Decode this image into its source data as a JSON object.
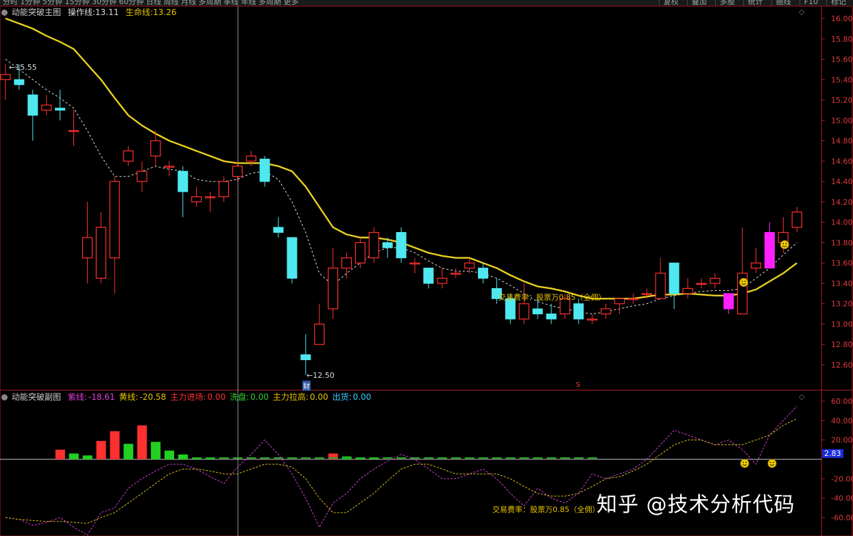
{
  "toolbar": {
    "left_text": "分时 1分钟 5分钟 15分钟 30分钟 60分钟 日线 周线 月线 多周期 季线 年线 多周期 更多",
    "right_items": [
      "复权",
      "叠加",
      "多股",
      "统计",
      "画线",
      "F10",
      "标记"
    ]
  },
  "main_panel": {
    "indicator_name": "动能突破主图",
    "op_label": "操作线:",
    "op_value": "13.11",
    "life_label": "生命线:",
    "life_value": "13.26",
    "high_label": "15.55",
    "low_label": "12.50",
    "annotation": "交易费率：股票万0.85（全佣）",
    "cai_tag": "财",
    "s_marker": "S"
  },
  "sub_panel": {
    "indicator_name": "动能突破副图",
    "items": [
      {
        "label": "紫线:",
        "value": "-18.61",
        "color": "#e040e0"
      },
      {
        "label": "黄线:",
        "value": "-20.58",
        "color": "#e6c200"
      },
      {
        "label": "主力进场:",
        "value": "0.00",
        "color": "#ff3030"
      },
      {
        "label": "洗盘:",
        "value": "0.00",
        "color": "#30d030"
      },
      {
        "label": "主力拉高:",
        "value": "0.00",
        "color": "#e6c200"
      },
      {
        "label": "出货:",
        "value": "0.00",
        "color": "#30d0ff"
      }
    ],
    "annotation": "交易费率：股票万0.85（全佣）",
    "current_value": "2.83"
  },
  "watermark": "知乎 @技术分析代码",
  "colors": {
    "up": "#ff3030",
    "down": "#4fe8f0",
    "yellow": "#e8d020",
    "magenta": "#ff20ff",
    "axis": "#b02020"
  },
  "chart_data": [
    {
      "type": "candlestick",
      "title": "动能突破主图",
      "ylim": [
        12.4,
        16.1
      ],
      "yticks": [
        "16.00",
        "15.80",
        "15.60",
        "15.40",
        "15.20",
        "15.00",
        "14.80",
        "14.60",
        "14.40",
        "14.20",
        "14.00",
        "13.80",
        "13.60",
        "13.40",
        "13.20",
        "13.00",
        "12.80",
        "12.60"
      ],
      "candles": [
        [
          15.4,
          15.45,
          15.55,
          15.2
        ],
        [
          15.4,
          15.35,
          15.55,
          15.3
        ],
        [
          15.25,
          15.05,
          15.3,
          14.8
        ],
        [
          15.1,
          15.15,
          15.25,
          15.05
        ],
        [
          15.12,
          15.1,
          15.3,
          15.0
        ],
        [
          14.9,
          14.9,
          15.1,
          14.75
        ],
        [
          13.65,
          13.85,
          14.2,
          13.4
        ],
        [
          13.45,
          13.95,
          14.1,
          13.4
        ],
        [
          13.65,
          14.4,
          14.45,
          13.3
        ],
        [
          14.6,
          14.7,
          14.75,
          14.55
        ],
        [
          14.4,
          14.5,
          14.6,
          14.3
        ],
        [
          14.65,
          14.8,
          14.9,
          14.55
        ],
        [
          14.55,
          14.55,
          14.6,
          14.45
        ],
        [
          14.5,
          14.3,
          14.55,
          14.05
        ],
        [
          14.2,
          14.25,
          14.35,
          14.15
        ],
        [
          14.25,
          14.25,
          14.3,
          14.1
        ],
        [
          14.25,
          14.4,
          14.45,
          14.2
        ],
        [
          14.45,
          14.55,
          14.6,
          14.4
        ],
        [
          14.6,
          14.65,
          14.7,
          14.55
        ],
        [
          14.62,
          14.4,
          14.65,
          14.35
        ],
        [
          13.95,
          13.9,
          14.05,
          13.85
        ],
        [
          13.85,
          13.45,
          13.85,
          13.4
        ],
        [
          12.7,
          12.65,
          12.9,
          12.5
        ],
        [
          12.8,
          13.0,
          13.2,
          12.8
        ],
        [
          13.15,
          13.55,
          13.75,
          13.05
        ],
        [
          13.55,
          13.65,
          13.7,
          13.45
        ],
        [
          13.6,
          13.8,
          13.85,
          13.55
        ],
        [
          13.65,
          13.9,
          13.95,
          13.6
        ],
        [
          13.8,
          13.75,
          13.85,
          13.65
        ],
        [
          13.9,
          13.65,
          13.95,
          13.6
        ],
        [
          13.6,
          13.6,
          13.65,
          13.5
        ],
        [
          13.55,
          13.4,
          13.55,
          13.35
        ],
        [
          13.4,
          13.45,
          13.55,
          13.35
        ],
        [
          13.5,
          13.5,
          13.55,
          13.45
        ],
        [
          13.55,
          13.6,
          13.65,
          13.5
        ],
        [
          13.55,
          13.45,
          13.6,
          13.4
        ],
        [
          13.35,
          13.25,
          13.45,
          13.2
        ],
        [
          13.25,
          13.05,
          13.3,
          13.0
        ],
        [
          13.05,
          13.2,
          13.4,
          13.0
        ],
        [
          13.15,
          13.1,
          13.25,
          13.05
        ],
        [
          13.1,
          13.05,
          13.2,
          13.0
        ],
        [
          13.1,
          13.25,
          13.3,
          13.05
        ],
        [
          13.2,
          13.05,
          13.25,
          13.0
        ],
        [
          13.05,
          13.05,
          13.1,
          13.0
        ],
        [
          13.1,
          13.15,
          13.2,
          13.05
        ],
        [
          13.2,
          13.25,
          13.25,
          13.1
        ],
        [
          13.25,
          13.25,
          13.3,
          13.2
        ],
        [
          13.3,
          13.3,
          13.35,
          13.25
        ],
        [
          13.25,
          13.5,
          13.65,
          13.25
        ],
        [
          13.6,
          13.3,
          13.6,
          13.15
        ],
        [
          13.3,
          13.35,
          13.45,
          13.25
        ],
        [
          13.4,
          13.4,
          13.45,
          13.35
        ],
        [
          13.4,
          13.45,
          13.5,
          13.35
        ],
        [
          13.3,
          13.15,
          13.3,
          13.1
        ],
        [
          13.1,
          13.5,
          13.95,
          13.1
        ],
        [
          13.55,
          13.6,
          13.75,
          13.5
        ],
        [
          13.55,
          13.9,
          14.0,
          13.55
        ],
        [
          13.8,
          13.9,
          14.05,
          13.7
        ],
        [
          13.95,
          14.1,
          14.15,
          13.9
        ]
      ],
      "magenta_candles": [
        53,
        56
      ],
      "yellow_line": [
        16.0,
        15.95,
        15.9,
        15.83,
        15.77,
        15.7,
        15.55,
        15.4,
        15.22,
        15.05,
        14.95,
        14.87,
        14.8,
        14.75,
        14.7,
        14.65,
        14.6,
        14.58,
        14.58,
        14.58,
        14.55,
        14.5,
        14.35,
        14.15,
        13.95,
        13.88,
        13.85,
        13.85,
        13.83,
        13.8,
        13.75,
        13.7,
        13.67,
        13.65,
        13.65,
        13.6,
        13.55,
        13.48,
        13.42,
        13.37,
        13.35,
        13.32,
        13.28,
        13.25,
        13.25,
        13.25,
        13.25,
        13.27,
        13.29,
        13.29,
        13.3,
        13.29,
        13.28,
        13.28,
        13.3,
        13.34,
        13.42,
        13.5,
        13.6
      ],
      "white_dash_line": [
        15.6,
        15.5,
        15.4,
        15.3,
        15.22,
        15.12,
        14.9,
        14.65,
        14.45,
        14.45,
        14.5,
        14.55,
        14.52,
        14.5,
        14.42,
        14.4,
        14.4,
        14.42,
        14.48,
        14.5,
        14.42,
        14.2,
        13.9,
        13.5,
        13.38,
        13.5,
        13.6,
        13.7,
        13.75,
        13.75,
        13.7,
        13.62,
        13.55,
        13.52,
        13.52,
        13.5,
        13.45,
        13.38,
        13.3,
        13.22,
        13.18,
        13.15,
        13.12,
        13.1,
        13.12,
        13.15,
        13.18,
        13.2,
        13.25,
        13.28,
        13.3,
        13.32,
        13.33,
        13.33,
        13.35,
        13.45,
        13.55,
        13.68,
        13.8
      ]
    },
    {
      "type": "bar+line",
      "title": "动能突破副图",
      "ylim": [
        -72,
        72
      ],
      "yticks": [
        "60.00",
        "40.00",
        "20.00",
        "-20.00",
        "-40.00",
        "-60.00"
      ],
      "bars": [
        {
          "i": 2,
          "v": 10,
          "c": "up"
        },
        {
          "i": 3,
          "v": 6,
          "c": "green"
        },
        {
          "i": 4,
          "v": 4,
          "c": "green"
        },
        {
          "i": 5,
          "v": 19,
          "c": "up"
        },
        {
          "i": 6,
          "v": 29,
          "c": "up"
        },
        {
          "i": 7,
          "v": 16,
          "c": "green"
        },
        {
          "i": 8,
          "v": 35,
          "c": "up"
        },
        {
          "i": 9,
          "v": 18,
          "c": "green"
        },
        {
          "i": 10,
          "v": 9,
          "c": "green"
        },
        {
          "i": 11,
          "v": 5,
          "c": "green"
        },
        {
          "i": 12,
          "v": 2,
          "c": "green"
        },
        {
          "i": 13,
          "v": 1,
          "c": "green"
        },
        {
          "i": 22,
          "v": 6,
          "c": "up"
        },
        {
          "i": 23,
          "v": 3,
          "c": "green"
        },
        {
          "i": 24,
          "v": 2,
          "c": "green"
        },
        {
          "i": 25,
          "v": 1,
          "c": "green"
        }
      ],
      "marker_bars": [
        {
          "i": 53,
          "v": -10,
          "c": "magenta"
        },
        {
          "i": 54,
          "v": -4,
          "c": "cyan"
        },
        {
          "i": 55,
          "v": -18,
          "c": "magenta"
        }
      ],
      "purple_line": [
        -60,
        -62,
        -68,
        -65,
        -60,
        -70,
        -78,
        -55,
        -50,
        -30,
        -20,
        -12,
        -5,
        -5,
        -10,
        -18,
        -25,
        -8,
        5,
        20,
        5,
        -15,
        -40,
        -70,
        -45,
        -35,
        -20,
        -10,
        -2,
        5,
        0,
        -10,
        -20,
        -20,
        -15,
        -10,
        -20,
        -35,
        -48,
        -30,
        -40,
        -45,
        -35,
        -15,
        -20,
        -15,
        -10,
        0,
        15,
        30,
        25,
        20,
        15,
        20,
        10,
        -5,
        25,
        40,
        55
      ],
      "yellow_line": [
        -60,
        -62,
        -63,
        -64,
        -64,
        -65,
        -66,
        -60,
        -55,
        -45,
        -35,
        -25,
        -15,
        -10,
        -10,
        -12,
        -15,
        -15,
        -10,
        -5,
        -5,
        -8,
        -20,
        -40,
        -55,
        -55,
        -45,
        -35,
        -22,
        -10,
        -5,
        -5,
        -10,
        -15,
        -15,
        -15,
        -15,
        -20,
        -28,
        -35,
        -38,
        -38,
        -35,
        -28,
        -20,
        -18,
        -12,
        -5,
        5,
        15,
        20,
        20,
        15,
        15,
        15,
        20,
        25,
        35,
        42
      ]
    }
  ]
}
